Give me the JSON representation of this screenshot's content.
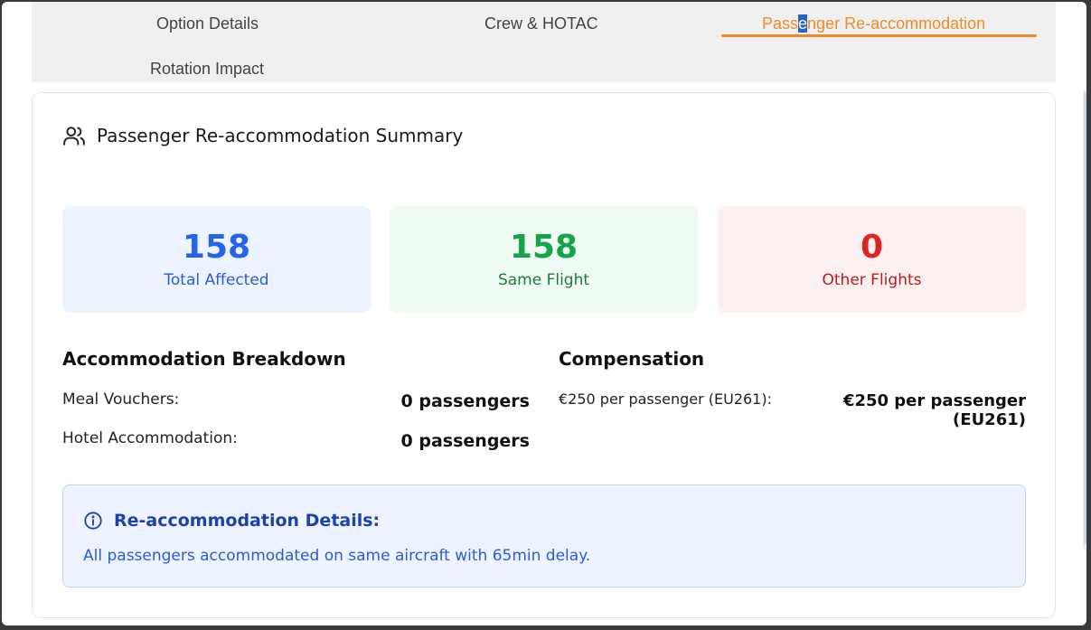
{
  "tabs": [
    {
      "label": "Option Details"
    },
    {
      "label": "Crew & HOTAC"
    },
    {
      "label_parts": [
        "Pass",
        "e",
        "nger Re-accommodation"
      ]
    },
    {
      "label": "Rotation Impact"
    }
  ],
  "summary": {
    "title": "Passenger Re-accommodation Summary",
    "icon": "users-icon"
  },
  "stats": [
    {
      "value": "158",
      "label": "Total Affected",
      "color": "#2563eb"
    },
    {
      "value": "158",
      "label": "Same Flight",
      "color": "#16a34a"
    },
    {
      "value": "0",
      "label": "Other Flights",
      "color": "#dc2626"
    }
  ],
  "breakdown": {
    "title": "Accommodation Breakdown",
    "rows": [
      {
        "label": "Meal Vouchers:",
        "value": "0 passengers"
      },
      {
        "label": "Hotel Accommodation:",
        "value": "0 passengers"
      }
    ]
  },
  "compensation": {
    "title": "Compensation",
    "rows": [
      {
        "label": "€250 per passenger (EU261):",
        "value": "€250 per passenger (EU261)"
      }
    ]
  },
  "details": {
    "icon": "info-icon",
    "title": "Re-accommodation Details:",
    "text": "All passengers accommodated on same aircraft with 65min delay."
  },
  "colors": {
    "accent": "#f08a24",
    "info": "#1e40af"
  }
}
